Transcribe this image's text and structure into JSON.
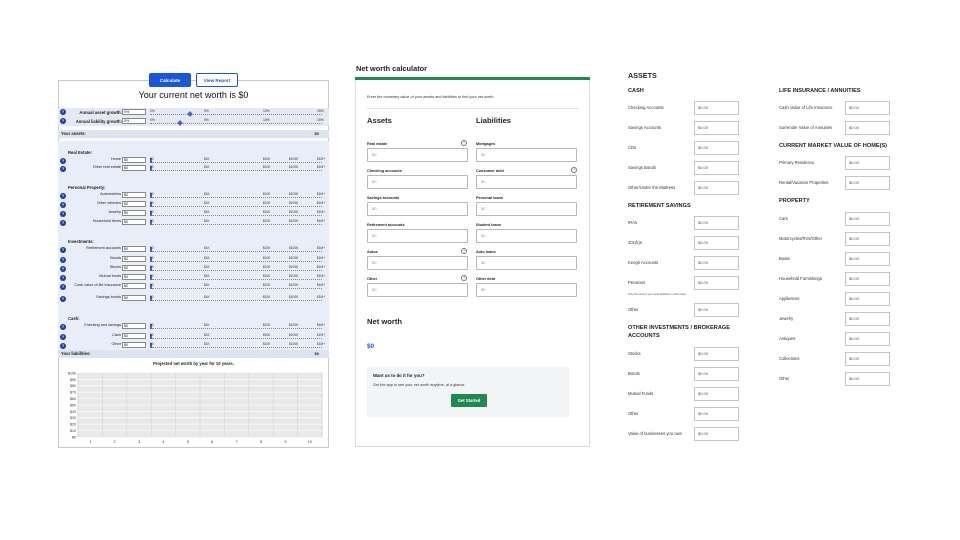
{
  "panel1": {
    "calculate_label": "Calculate",
    "view_report_label": "View Report",
    "title": "Your current net worth is $0",
    "asset_growth": {
      "label": "Annual asset growth:",
      "value": "0%",
      "ticks": [
        "0%",
        "5%",
        "10%",
        "15%"
      ]
    },
    "liability_growth": {
      "label": "Annual liability growth:",
      "value": "0%",
      "ticks": [
        "0%",
        "5%",
        "10%",
        "15%"
      ]
    },
    "assets_header": "Your assets:",
    "assets_total": "$0",
    "liabilities_header": "Your liabilities:",
    "liabilities_total": "$0",
    "slider_ticks": [
      "$0",
      "$1K",
      "$10K",
      "$100K",
      "$1M+"
    ],
    "icon": "question-circle-icon",
    "groups": [
      {
        "label": "Real Estate:",
        "rows": [
          {
            "label": "Home",
            "value": "$0"
          },
          {
            "label": "Other real estate",
            "value": "$0"
          }
        ]
      },
      {
        "label": "Personal Property:",
        "rows": [
          {
            "label": "Automobiles",
            "value": "$0"
          },
          {
            "label": "Other vehicles",
            "value": "$0"
          },
          {
            "label": "Jewelry",
            "value": "$0"
          },
          {
            "label": "Household items",
            "value": "$0"
          }
        ]
      },
      {
        "label": "Investments:",
        "rows": [
          {
            "label": "Retirement accounts",
            "value": "$0"
          },
          {
            "label": "Bonds",
            "value": "$0"
          },
          {
            "label": "Stocks",
            "value": "$0"
          },
          {
            "label": "Mutual funds",
            "value": "$0"
          },
          {
            "label": "Cash value of life insurance",
            "value": "$0"
          },
          {
            "label": "Savings bonds",
            "value": "$0"
          }
        ]
      },
      {
        "label": "Cash:",
        "rows": [
          {
            "label": "Checking and savings",
            "value": "$0"
          },
          {
            "label": "Cash",
            "value": "$0"
          },
          {
            "label": "Other",
            "value": "$0"
          }
        ]
      }
    ]
  },
  "chart_data": {
    "type": "bar",
    "title": "Projected net worth by year for 10 years.",
    "categories": [
      "1",
      "2",
      "3",
      "4",
      "5",
      "6",
      "7",
      "8",
      "9",
      "10"
    ],
    "values": [
      0,
      0,
      0,
      0,
      0,
      0,
      0,
      0,
      0,
      0
    ],
    "y_ticks": [
      "$100",
      "$90",
      "$80",
      "$70",
      "$60",
      "$50",
      "$40",
      "$30",
      "$20",
      "$10",
      "$0"
    ],
    "ylim": [
      0,
      100
    ],
    "grid": true
  },
  "panel2": {
    "title": "Net worth calculator",
    "intro": "Enter the monetary value of your assets and liabilities to find your net worth.",
    "assets_heading": "Assets",
    "liabilities_heading": "Liabilities",
    "help_glyph": "?",
    "assets": [
      {
        "label": "Real estate",
        "placeholder": "$0",
        "help": true
      },
      {
        "label": "Checking accounts",
        "placeholder": "$0",
        "help": false
      },
      {
        "label": "Savings accounts",
        "placeholder": "$0",
        "help": false
      },
      {
        "label": "Retirement accounts",
        "placeholder": "$0",
        "help": false
      },
      {
        "label": "Autos",
        "placeholder": "$0",
        "help": true
      },
      {
        "label": "Other",
        "placeholder": "$0",
        "help": true
      }
    ],
    "liabilities": [
      {
        "label": "Mortgages",
        "placeholder": "$0",
        "help": false
      },
      {
        "label": "Consumer debt",
        "placeholder": "$0",
        "help": true
      },
      {
        "label": "Personal loans",
        "placeholder": "$0",
        "help": false
      },
      {
        "label": "Student loans",
        "placeholder": "$0",
        "help": false
      },
      {
        "label": "Auto loans",
        "placeholder": "$0",
        "help": false
      },
      {
        "label": "Other debt",
        "placeholder": "$0",
        "help": false
      }
    ],
    "net_worth_heading": "Net worth",
    "net_worth_value": "$0",
    "promo_heading": "Want us to do it for you?",
    "promo_text": "Get the app to see your net worth anytime, at a glance.",
    "get_started_label": "Get Started"
  },
  "panel3": {
    "assets_heading": "ASSETS",
    "cash": {
      "heading": "CASH",
      "rows": [
        {
          "label": "Checking Accounts",
          "value": "$0.00"
        },
        {
          "label": "Savings Accounts",
          "value": "$0.00"
        },
        {
          "label": "CDs",
          "value": "$0.00"
        },
        {
          "label": "Savings Bonds",
          "value": "$0.00"
        },
        {
          "label": "Other/Under the Mattress",
          "value": "$0.00"
        }
      ]
    },
    "retirement": {
      "heading": "RETIREMENT SAVINGS",
      "rows": [
        {
          "label": "IRAs",
          "value": "$0.00"
        },
        {
          "label": "401(k)s",
          "value": "$0.00"
        },
        {
          "label": "Keogh Accounts",
          "value": "$0.00"
        },
        {
          "label": "Pensions",
          "value": "$0.00"
        },
        {
          "label": "Other",
          "value": "$0.00"
        }
      ],
      "pensions_note": "Only the amount you could withdraw in cash today"
    },
    "other_investments": {
      "heading": "OTHER INVESTMENTS / BROKERAGE ACCOUNTS",
      "rows": [
        {
          "label": "Stocks",
          "value": "$0.00"
        },
        {
          "label": "Bonds",
          "value": "$0.00"
        },
        {
          "label": "Mutual Funds",
          "value": "$0.00"
        },
        {
          "label": "Other",
          "value": "$0.00"
        },
        {
          "label": "Value of businesses you own",
          "value": "$0.00"
        }
      ]
    },
    "life_insurance": {
      "heading": "LIFE INSURANCE / ANNUITIES",
      "rows": [
        {
          "label": "Cash Value of Life Insurance",
          "value": "$0.00"
        },
        {
          "label": "Surrender Value of Annuities",
          "value": "$0.00"
        }
      ]
    },
    "home_value": {
      "heading": "CURRENT MARKET VALUE OF HOME(S)",
      "rows": [
        {
          "label": "Primary Residence",
          "value": "$0.00"
        },
        {
          "label": "Rental/Vacation Properties",
          "value": "$0.00"
        }
      ]
    },
    "property": {
      "heading": "PROPERTY",
      "rows": [
        {
          "label": "Cars",
          "value": "$0.00"
        },
        {
          "label": "Motorcycles/RVs/Other",
          "value": "$0.00"
        },
        {
          "label": "Boats",
          "value": "$0.00"
        },
        {
          "label": "Household Furnishings",
          "value": "$0.00"
        },
        {
          "label": "Appliances",
          "value": "$0.00"
        },
        {
          "label": "Jewelry",
          "value": "$0.00"
        },
        {
          "label": "Antiques",
          "value": "$0.00"
        },
        {
          "label": "Collections",
          "value": "$0.00"
        },
        {
          "label": "Other",
          "value": "$0.00"
        }
      ]
    }
  }
}
